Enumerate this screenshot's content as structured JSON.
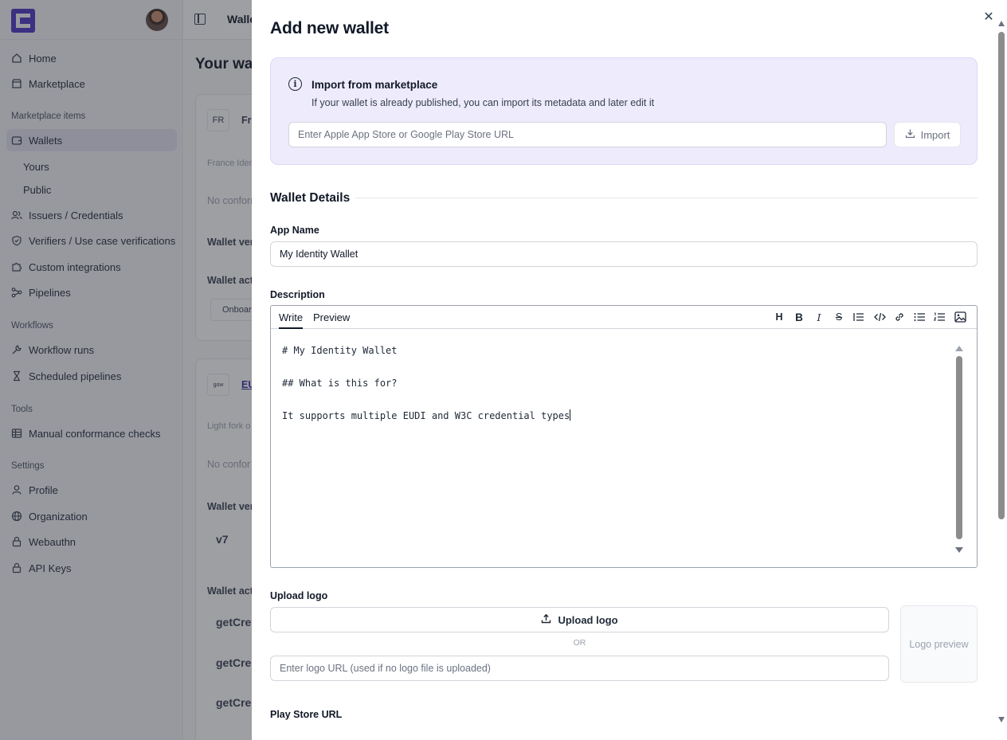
{
  "sidebar": {
    "nav": [
      {
        "label": "Home",
        "icon": "home-icon"
      },
      {
        "label": "Marketplace",
        "icon": "store-icon"
      }
    ],
    "marketplace_section": "Marketplace items",
    "wallets": "Wallets",
    "sub_yours": "Yours",
    "sub_public": "Public",
    "issuers": "Issuers / Credentials",
    "verifiers": "Verifiers / Use case verifications",
    "custom": "Custom integrations",
    "pipelines": "Pipelines",
    "workflows_section": "Workflows",
    "workflow_runs": "Workflow runs",
    "scheduled": "Scheduled pipelines",
    "tools_section": "Tools",
    "manual": "Manual conformance checks",
    "settings_section": "Settings",
    "profile": "Profile",
    "organization": "Organization",
    "webauthn": "Webauthn",
    "api_keys": "API Keys"
  },
  "background": {
    "crumb": "Walle",
    "page_title": "Your wall",
    "card1_badge": "FR",
    "card1_name": "Fr",
    "card1_sub": "France Identi",
    "card1_noconf": "No conform",
    "card1_versions": "Wallet ver",
    "card1_actions": "Wallet act",
    "card1_onboard": "Onboar",
    "card2_badge": "gow",
    "card2_name": "EU",
    "card2_sub": "Light fork o",
    "card2_noconf": "No confor",
    "card2_versions": "Wallet ver",
    "card2_version": "v7",
    "card2_actions": "Wallet act",
    "card2_get1": "getCre",
    "card2_get2": "getCre",
    "card2_get3": "getCre"
  },
  "dialog": {
    "title": "Add new wallet",
    "import": {
      "title": "Import from marketplace",
      "description": "If your wallet is already published, you can import its metadata and later edit it",
      "placeholder": "Enter Apple App Store or Google Play Store URL",
      "button": "Import"
    },
    "section_title": "Wallet Details",
    "app_name_label": "App Name",
    "app_name_value": "My Identity Wallet",
    "description_label": "Description",
    "editor": {
      "tab_write": "Write",
      "tab_preview": "Preview",
      "lines": [
        "# My Identity Wallet",
        "",
        "## What is this for?",
        "",
        "It supports multiple EUDI and W3C credential types"
      ]
    },
    "upload_logo_label": "Upload logo",
    "upload_button": "Upload logo",
    "or_text": "OR",
    "logo_url_placeholder": "Enter logo URL (used if no logo file is uploaded)",
    "logo_preview": "Logo preview",
    "play_store_label": "Play Store URL"
  },
  "colors": {
    "accent": "#4b36c2",
    "import_bg": "#eeebfc",
    "active_nav": "#e4e2f3"
  }
}
